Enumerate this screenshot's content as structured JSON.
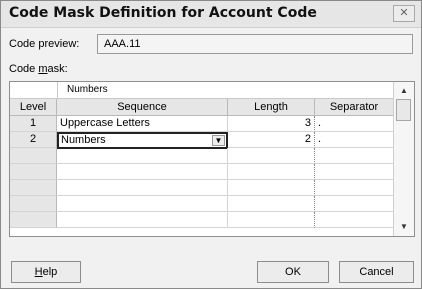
{
  "dialog": {
    "title": "Code Mask Definition for Account Code",
    "close_glyph": "✕"
  },
  "code_preview": {
    "label": "Code preview:",
    "value": "AAA.11"
  },
  "code_mask": {
    "label_pre": "Code ",
    "label_accel": "m",
    "label_post": "ask:"
  },
  "grid": {
    "top_value": "Numbers",
    "columns": [
      "Level",
      "Sequence",
      "Length",
      "Separator"
    ],
    "rows": [
      {
        "level": "1",
        "sequence": "Uppercase Letters",
        "length": "3",
        "separator": "."
      },
      {
        "level": "2",
        "sequence": "Numbers",
        "length": "2",
        "separator": "."
      }
    ],
    "dropdown_glyph": "▼",
    "scroll_up_glyph": "▲",
    "scroll_down_glyph": "▼"
  },
  "buttons": {
    "help_accel": "H",
    "help_rest": "elp",
    "ok": "OK",
    "cancel": "Cancel"
  },
  "icons": {
    "close": "close-icon",
    "dropdown": "chevron-down-icon",
    "scroll_up": "arrow-up-icon",
    "scroll_down": "arrow-down-icon"
  }
}
